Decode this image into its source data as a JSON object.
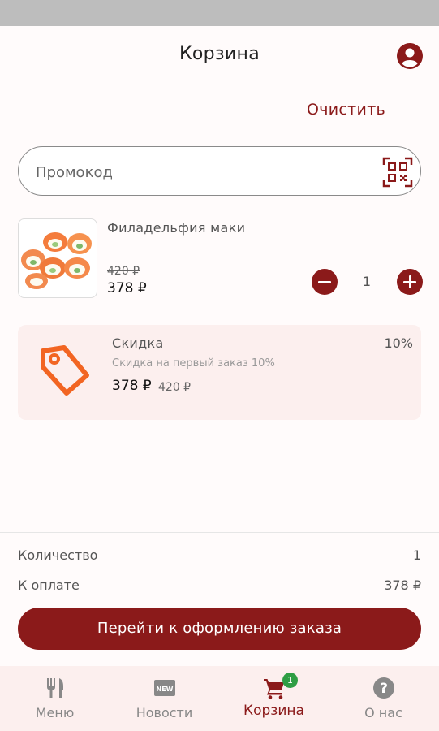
{
  "header": {
    "title": "Корзина",
    "profile_icon": "account-circle-icon"
  },
  "actions": {
    "clear_label": "Очистить"
  },
  "promo": {
    "placeholder": "Промокод",
    "value": "",
    "scan_icon": "qr-code-scan-icon"
  },
  "cart_items": [
    {
      "name": "Филадельфия маки",
      "old_price": "420 ₽",
      "price": "378 ₽",
      "quantity": "1"
    }
  ],
  "discount": {
    "icon": "price-tag-icon",
    "title": "Скидка",
    "percent": "10%",
    "description": "Скидка на первый заказ 10%",
    "price": "378 ₽",
    "old_price": "420 ₽"
  },
  "summary": {
    "quantity_label": "Количество",
    "quantity_value": "1",
    "total_label": "К оплате",
    "total_value": "378 ₽"
  },
  "checkout": {
    "label": "Перейти к оформлению заказа"
  },
  "tabbar": {
    "tabs": [
      {
        "label": "Меню",
        "icon": "fork-knife-icon"
      },
      {
        "label": "Новости",
        "icon": "new-badge-icon"
      },
      {
        "label": "Корзина",
        "icon": "cart-icon",
        "active": true
      },
      {
        "label": "О нас",
        "icon": "help-circle-icon"
      }
    ],
    "cart_badge": "1"
  },
  "colors": {
    "accent": "#8b1a1a",
    "card_bg": "#fcefee",
    "tag_orange": "#f26522",
    "badge_green": "#2f9e44"
  }
}
